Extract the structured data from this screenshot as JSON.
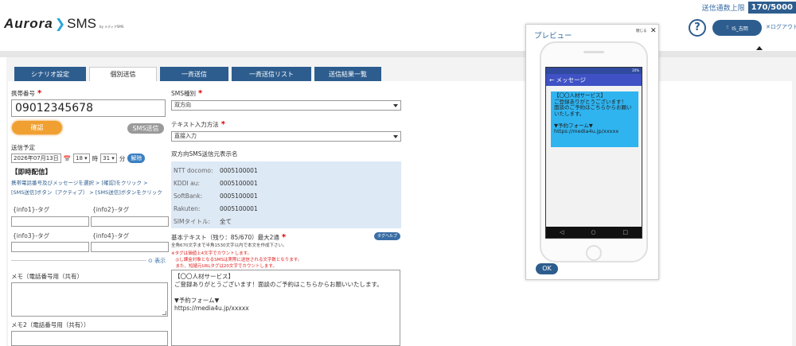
{
  "header": {
    "logo": {
      "aurora": "Aurora",
      "sms": "SMS",
      "by": "by メディアSMS"
    },
    "quota_label": "送信通数上限",
    "quota_value": "170/5000",
    "user_label": "IS_吉岡",
    "logout": "ログアウト"
  },
  "tabs": [
    {
      "label": "シナリオ設定"
    },
    {
      "label": "個別送信"
    },
    {
      "label": "一斉送信"
    },
    {
      "label": "一斉送信リスト"
    },
    {
      "label": "送信結果一覧"
    }
  ],
  "left": {
    "phone_label": "携帯番号",
    "phone_value": "09012345678",
    "confirm_button": "確認",
    "sms_send_button": "SMS送信",
    "schedule_label": "送信予定",
    "date": "2026年07月13日",
    "hour": "18",
    "hour_unit": "時",
    "minute": "31",
    "minute_unit": "分",
    "cancel_button": "解除",
    "immediate": "【即時配信】",
    "steps_line1": "携帯電話番号及びメッセージを選択 > [確認]をクリック >",
    "steps_line2": "[SMS送信]ボタン（アクティブ） > [SMS送信]ボタンをクリック",
    "tags": [
      "{info1}-タグ",
      "{info2}-タグ",
      "{info3}-タグ",
      "{info4}-タグ"
    ],
    "show_link": "表示",
    "memo1_label": "メモ（電話番号用（共有）",
    "memo2_label": "メモ2（電話番号用（共有））"
  },
  "middle": {
    "sms_type_label": "SMS種別",
    "sms_type_value": "双方向",
    "input_method_label": "テキスト入力方法",
    "input_method_value": "直接入力",
    "sender_label": "双方向SMS送信元表示名",
    "senders": [
      {
        "carrier": "NTT docomo:",
        "value": "0005100001"
      },
      {
        "carrier": "KDDI au:",
        "value": "0005100001"
      },
      {
        "carrier": "SoftBank:",
        "value": "0005100001"
      },
      {
        "carrier": "Rakuten:",
        "value": "0005100001"
      },
      {
        "carrier": "SIMタイトル:",
        "value": "全て"
      }
    ],
    "body_label": "基本テキスト（残り：85/670）最大2通",
    "body_note": "全角670文字まで半角1530文字以内で本文を作成下さい。",
    "note_red1": "※タグは価値上4文字でカウントします。",
    "note_red2": "　◎し課金対象となるSMSは実際に送信される文字数となります。",
    "note_red3": "　また、短縮元URLタグは20文字でカウントします。",
    "help_button": "タグヘルプ",
    "body_text": "【〇〇人材サービス】\nご登録ありがとうございます！面談のご予約はこちらからお願いいたします。\n\n▼予約フォーム▼\nhttps://media4u.jp/xxxxx"
  },
  "preview": {
    "title": "プレビュー",
    "close_text": "閉じる",
    "status_text": "20%",
    "message_header": "← メッセージ",
    "bubble_text": "【〇〇人材サービス】\nご登録ありがとうございます！\n面談のご予約はこちらからお願いいたします。\n\n▼予約フォーム▼\nhttps://media4u.jp/xxxxx",
    "ok_button": "OK"
  },
  "colors": {
    "accent": "#2d5d8e",
    "orange": "#f0a030",
    "bubble": "#2fb4f0",
    "sender_bg": "#dde9f5"
  }
}
